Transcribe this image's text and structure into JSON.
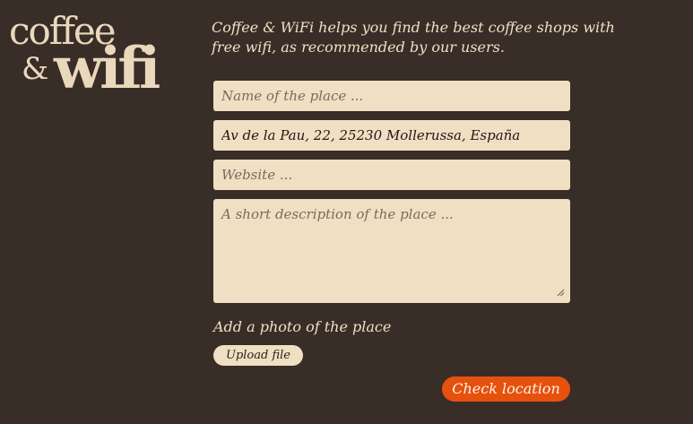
{
  "logo": {
    "line1": "coffee",
    "ampersand": "&",
    "line2": "wifi"
  },
  "intro": {
    "text": "Coffee & WiFi helps you find the best coffee shops with free wifi, as recommended by our users."
  },
  "form": {
    "name": {
      "placeholder": "Name of the place ...",
      "value": ""
    },
    "address": {
      "placeholder": "",
      "value": "Av de la Pau, 22, 25230 Mollerussa, España"
    },
    "website": {
      "placeholder": "Website ...",
      "value": ""
    },
    "description": {
      "placeholder": "A short description of the place ...",
      "value": ""
    },
    "photo_label": "Add a photo of the place",
    "upload_label": "Upload file",
    "submit_label": "Check location"
  },
  "colors": {
    "background": "#392d28",
    "field": "#f0dfc3",
    "accent": "#e6510e",
    "text_light": "#f0e0c4"
  }
}
